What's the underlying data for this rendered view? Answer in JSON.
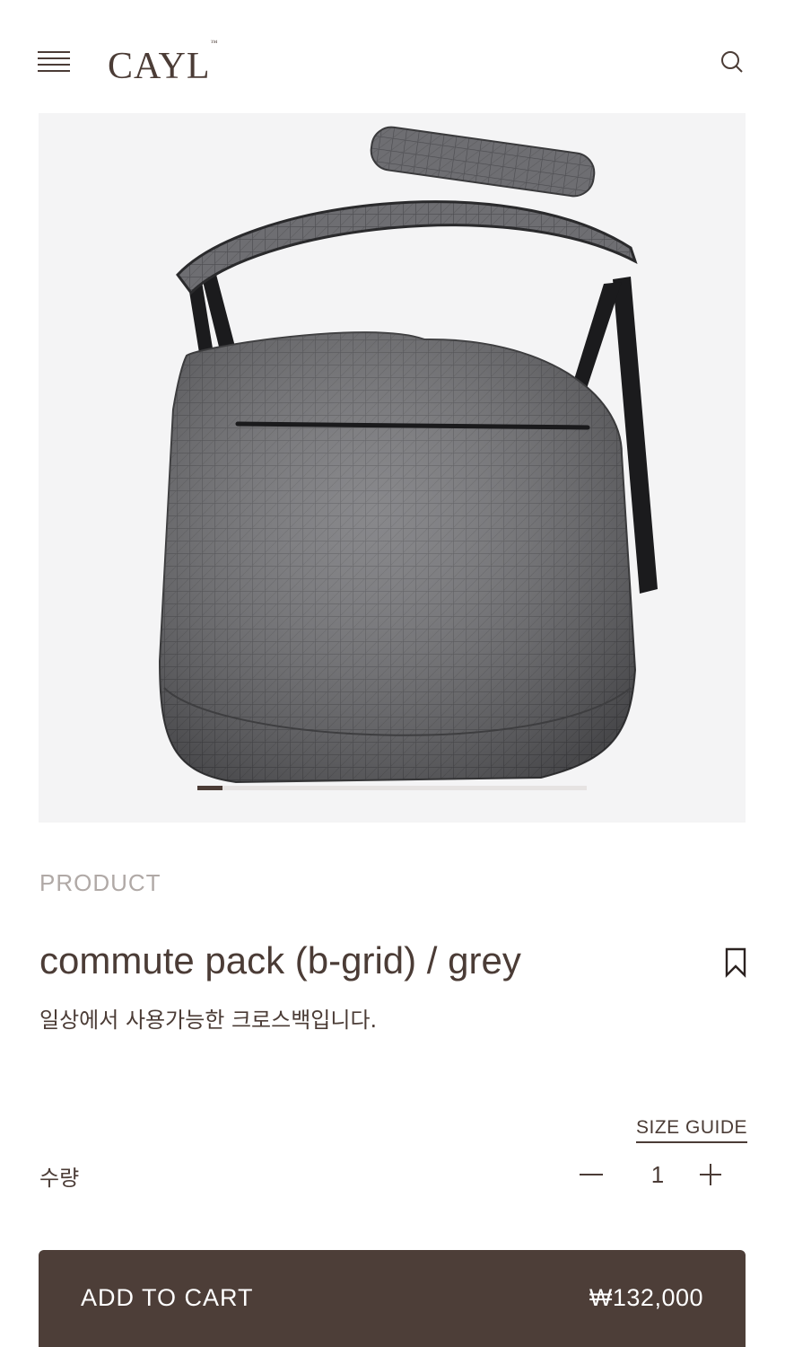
{
  "header": {
    "logo": "CAYL",
    "logo_tm": "™",
    "menu_icon": "hamburger-menu-icon",
    "search_icon": "search-icon"
  },
  "gallery": {
    "image_alt": "grey grid-pattern crossbody bag",
    "current_index": 1,
    "progress_fraction": 0.065,
    "colors": {
      "indicator_active": "#4b3c36",
      "indicator_track": "#e6e3e2"
    }
  },
  "product": {
    "category": "PRODUCT",
    "title": "commute pack (b-grid) / grey",
    "description": "일상에서 사용가능한 크로스백입니다.",
    "bookmark_icon": "bookmark-icon"
  },
  "options": {
    "size_guide": "SIZE GUIDE",
    "quantity_label": "수량",
    "quantity_value": "1",
    "minus_icon": "minus-icon",
    "plus_icon": "plus-icon"
  },
  "cart": {
    "label": "ADD TO CART",
    "price": "₩132,000",
    "color": "#4d3e38"
  }
}
